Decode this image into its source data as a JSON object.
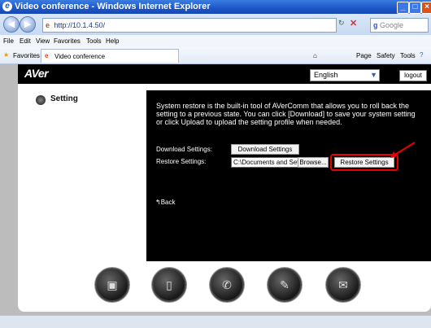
{
  "browser": {
    "window_title": "Video conference - Windows Internet Explorer",
    "url": "http://10.1.4.50/",
    "search_placeholder": "Google",
    "menu": [
      "File",
      "Edit",
      "View",
      "Favorites",
      "Tools",
      "Help"
    ],
    "favorites_label": "Favorites",
    "tab_title": "Video conference",
    "command_items": [
      "Page",
      "Safety",
      "Tools"
    ]
  },
  "app": {
    "logo": "AVer",
    "language": "English",
    "logout_label": "logout",
    "section_title": "Setting",
    "description": "System restore is the built-in tool of AVerComm that allows you to roll back the setting to a previous state. You can click [Download] to save your system setting or click Upload to upload the setting profile when needed.",
    "download": {
      "label": "Download Settings:",
      "button": "Download Settings"
    },
    "restore": {
      "label": "Restore Settings:",
      "path": "C:\\Documents and Setting",
      "browse": "Browse...",
      "button": "Restore Settings"
    },
    "back_label": "Back",
    "bottom_icons": [
      "monitor-icon",
      "tablet-icon",
      "phone-icon",
      "wrench-icon",
      "mail-icon"
    ]
  }
}
